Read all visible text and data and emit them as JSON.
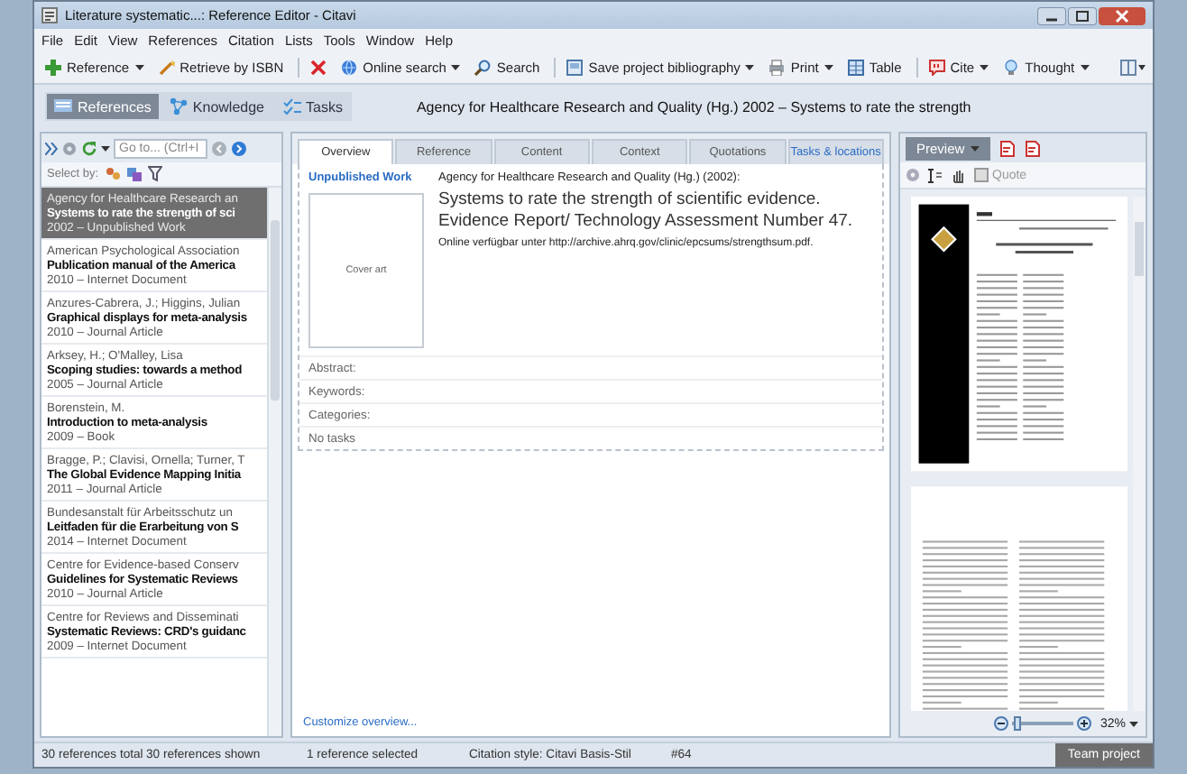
{
  "window": {
    "title": "Literature systematic...: Reference Editor - Citavi"
  },
  "menu": [
    "File",
    "Edit",
    "View",
    "References",
    "Citation",
    "Lists",
    "Tools",
    "Window",
    "Help"
  ],
  "toolbar": [
    {
      "label": "Reference",
      "dropdown": true,
      "separator_before": false
    },
    {
      "label": "Retrieve by ISBN",
      "dropdown": false,
      "separator_before": false
    },
    {
      "dropdown": false,
      "separator_before": true
    },
    {
      "label": "Online search",
      "dropdown": true,
      "separator_before": false
    },
    {
      "label": "Search",
      "dropdown": false,
      "separator_before": false
    },
    {
      "label": "Save project bibliography",
      "dropdown": true,
      "separator_before": true
    },
    {
      "label": "Print",
      "dropdown": true,
      "separator_before": false
    },
    {
      "label": "Table",
      "dropdown": false,
      "separator_before": false
    },
    {
      "label": "Cite",
      "dropdown": true,
      "separator_before": true
    },
    {
      "label": "Thought",
      "dropdown": true,
      "separator_before": false
    }
  ],
  "sections": [
    {
      "label": "References",
      "selected": true
    },
    {
      "label": "Knowledge",
      "selected": false
    },
    {
      "label": "Tasks",
      "selected": false
    }
  ],
  "header": "Agency for Healthcare Research and Quality (Hg.) 2002 – Systems to rate the strength",
  "left_pane": {
    "goto": {
      "placeholder": "Go to... (Ctrl+I"
    },
    "select_by": "Select by:",
    "references": [
      {
        "author": "Agency for Healthcare Research an",
        "title": "Systems to rate the strength of sci",
        "meta": "2002 – Unpublished Work",
        "selected": true
      },
      {
        "author": "American Psychological Association",
        "title": "Publication manual of the America",
        "meta": "2010 – Internet Document",
        "selected": false
      },
      {
        "author": "Anzures-Cabrera, J.; Higgins, Julian",
        "title": "Graphical displays for meta-analysis",
        "meta": "2010 – Journal Article",
        "selected": false
      },
      {
        "author": "Arksey, H.; O'Malley, Lisa",
        "title": "Scoping studies: towards a method",
        "meta": "2005 – Journal Article",
        "selected": false
      },
      {
        "author": "Borenstein, M.",
        "title": "Introduction to meta-analysis",
        "meta": "2009 – Book",
        "selected": false
      },
      {
        "author": "Bragge, P.; Clavisi, Ornella; Turner, T",
        "title": "The Global Evidence Mapping Initia",
        "meta": "2011 – Journal Article",
        "selected": false
      },
      {
        "author": "Bundesanstalt für Arbeitsschutz un",
        "title": "Leitfaden für die Erarbeitung von S",
        "meta": "2014 – Internet Document",
        "selected": false
      },
      {
        "author": "Centre for Evidence-based Conserv",
        "title": "Guidelines for Systematic Reviews",
        "meta": "2010 – Journal Article",
        "selected": false
      },
      {
        "author": "Centre for Reviews and Disseminati",
        "title": "Systematic Reviews: CRD's guidanc",
        "meta": "2009 – Internet Document",
        "selected": false
      }
    ]
  },
  "detail": {
    "tabs": [
      {
        "label": "Overview",
        "selected": true,
        "highlighted": false
      },
      {
        "label": "Reference",
        "selected": false,
        "highlighted": false
      },
      {
        "label": "Content",
        "selected": false,
        "highlighted": false
      },
      {
        "label": "Context",
        "selected": false,
        "highlighted": false
      },
      {
        "label": "Quotations",
        "selected": false,
        "highlighted": false
      },
      {
        "label": "Tasks & locations",
        "selected": false,
        "highlighted": true
      }
    ],
    "type": "Unpublished Work",
    "cover": "Cover art",
    "citation": {
      "author": "Agency for Healthcare Research and Quality (Hg.) (2002):",
      "title": "Systems to rate the strength of scientific evidence. Evidence Report/ Technology Assessment Number 47.",
      "online": "Online verfügbar unter http://archive.ahrq.gov/clinic/epcsums/strengthsum.pdf."
    },
    "fields": [
      "Abstract:",
      "Keywords:",
      "Categories:",
      "No tasks"
    ],
    "customize": "Customize overview..."
  },
  "preview": {
    "button": "Preview",
    "quote": "Quote",
    "zoom": {
      "level": 0.08,
      "reading": "32%"
    }
  },
  "status": {
    "total": "30 references total",
    "shown": "30 references shown",
    "selected": "1 reference selected",
    "style": "Citation style: Citavi Basis-Stil",
    "number": "#64",
    "team": "Team project"
  }
}
